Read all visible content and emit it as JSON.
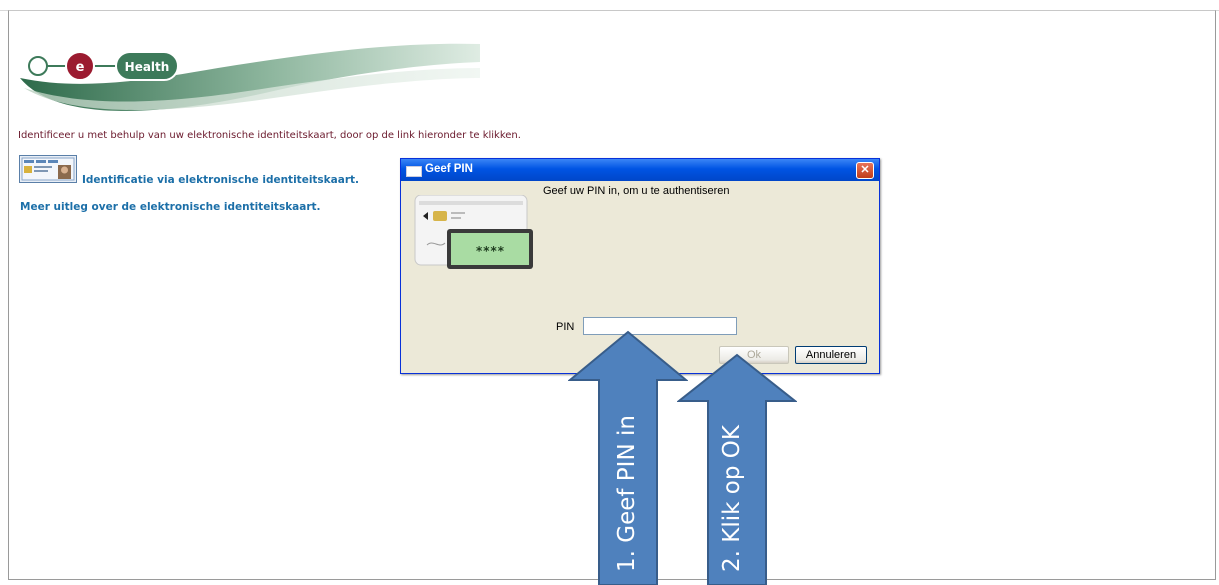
{
  "logo": {
    "letter_e": "e",
    "word_health": "Health"
  },
  "intro_text": "Identificeer u met behulp van uw elektronische identiteitskaart, door op de link hieronder te klikken.",
  "links": {
    "eid_login": "Identificatie via elektronische identiteitskaart.",
    "more_info": "Meer uitleg over de elektronische identiteitskaart."
  },
  "dialog": {
    "title": "Geef PIN",
    "close_glyph": "✕",
    "prompt": "Geef uw PIN in, om u te authentiseren",
    "card_mask": "****",
    "pin_label": "PIN",
    "pin_value": "",
    "ok_label": "Ok",
    "cancel_label": "Annuleren"
  },
  "annotations": {
    "step1": "1. Geef PIN in",
    "step2": "2. Klik op OK",
    "arrow_color": "#4f81bd"
  },
  "colors": {
    "intro_text": "#6b1a2d",
    "link": "#1c6fa8",
    "logo_red": "#9b1b30",
    "logo_green": "#3d7a5a"
  }
}
